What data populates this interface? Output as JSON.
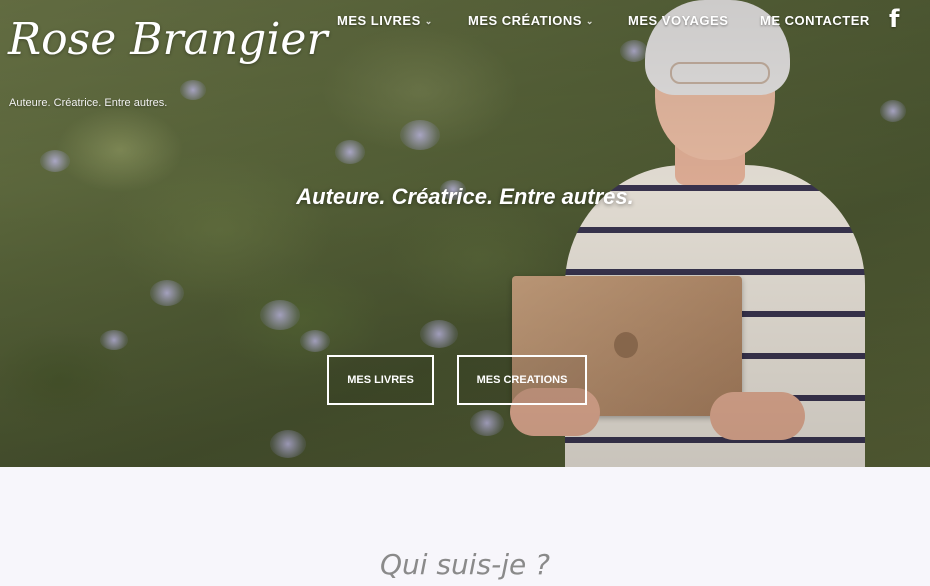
{
  "site": {
    "logo": "Rose Brangier",
    "tagline": "Auteure. Créatrice. Entre autres."
  },
  "nav": {
    "items": [
      {
        "label": "MES LIVRES",
        "has_dropdown": true
      },
      {
        "label": "MES CRÉATIONS",
        "has_dropdown": true
      },
      {
        "label": "MES VOYAGES",
        "has_dropdown": false
      },
      {
        "label": "ME CONTACTER",
        "has_dropdown": false
      }
    ],
    "social_icon": "facebook-icon",
    "social_glyph": "f"
  },
  "hero": {
    "title": "Auteure. Créatrice. Entre autres.",
    "buttons": [
      "MES LIVRES",
      "MES CREATIONS"
    ]
  },
  "section": {
    "title": "Qui suis-je ?"
  },
  "colors": {
    "background": "#f7f6fb",
    "section_title": "#8a8a8a",
    "nav_text": "#ffffff"
  }
}
